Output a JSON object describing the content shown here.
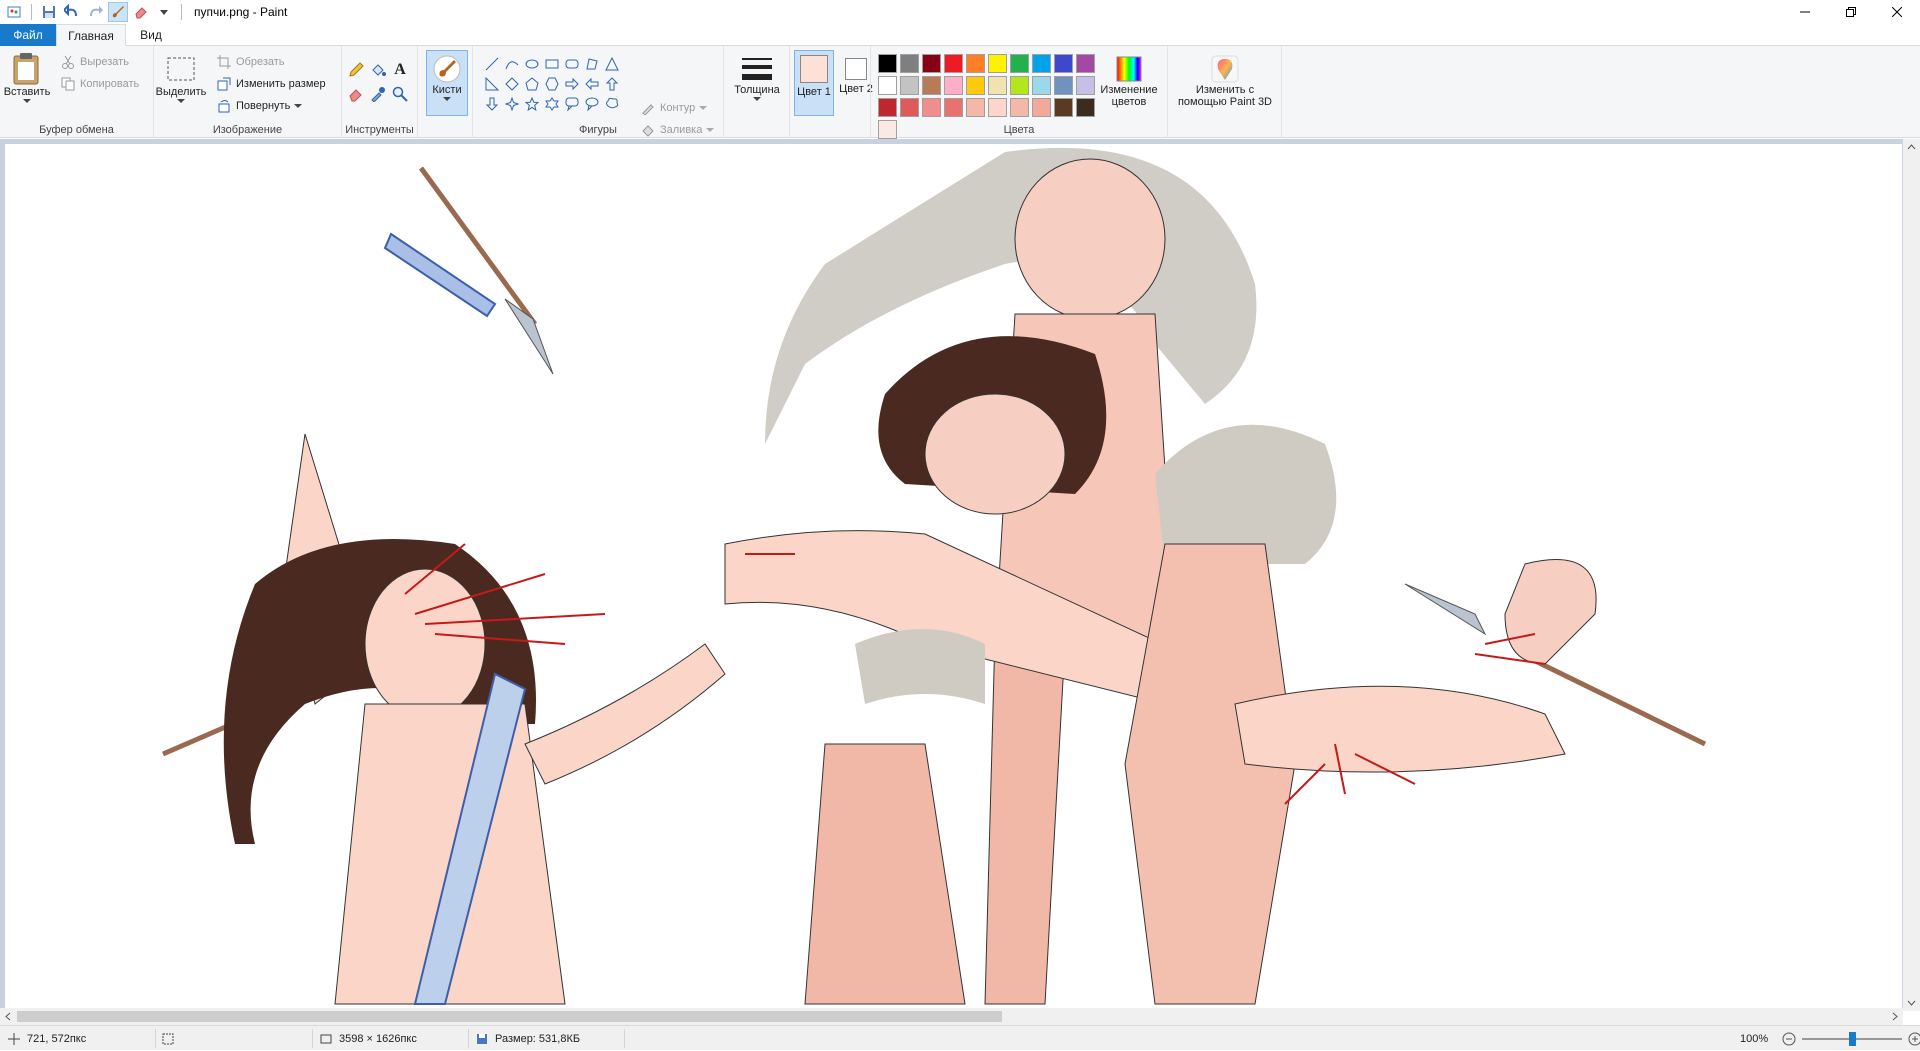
{
  "window": {
    "title": "пупчи.png - Paint"
  },
  "tabs": {
    "file": "Файл",
    "home": "Главная",
    "view": "Вид"
  },
  "clipboard": {
    "paste": "Вставить",
    "cut": "Вырезать",
    "copy": "Копировать",
    "label": "Буфер обмена"
  },
  "image": {
    "select": "Выделить",
    "crop": "Обрезать",
    "resize": "Изменить размер",
    "rotate": "Повернуть",
    "label": "Изображение"
  },
  "tools": {
    "label": "Инструменты",
    "text_tool": "A"
  },
  "brushes": {
    "label": "Кисти"
  },
  "shapes": {
    "outline": "Контур",
    "fill": "Заливка",
    "label": "Фигуры"
  },
  "thickness": {
    "label": "Толщина"
  },
  "colors": {
    "color1": "Цвет 1",
    "color2": "Цвет 2",
    "edit_colors": "Изменение цветов",
    "paint3d": "Изменить с помощью Paint 3D",
    "label": "Цвета",
    "color1_value": "#fde0d6",
    "color2_value": "#ffffff",
    "palette": [
      "#000000",
      "#7f7f7f",
      "#880015",
      "#ed1c24",
      "#ff7f27",
      "#fff200",
      "#22b14c",
      "#00a2e8",
      "#3f48cc",
      "#a349a4",
      "#ffffff",
      "#c3c3c3",
      "#b97a57",
      "#ffaec9",
      "#ffc90e",
      "#efe4b0",
      "#b5e61d",
      "#99d9ea",
      "#7092be",
      "#c8bfe7",
      "#c0272d",
      "#e05a5a",
      "#f08e8e",
      "#e8736e",
      "#f5b7a8",
      "#fcd6cb",
      "#f4b8a8",
      "#f2a99a",
      "#5a3a22",
      "#3d2b1f",
      "#fbe9e4"
    ]
  },
  "status": {
    "cursor": "721, 572пкс",
    "image_size": "3598 × 1626пкс",
    "file_size": "Размер: 531,8КБ",
    "zoom": "100%"
  }
}
